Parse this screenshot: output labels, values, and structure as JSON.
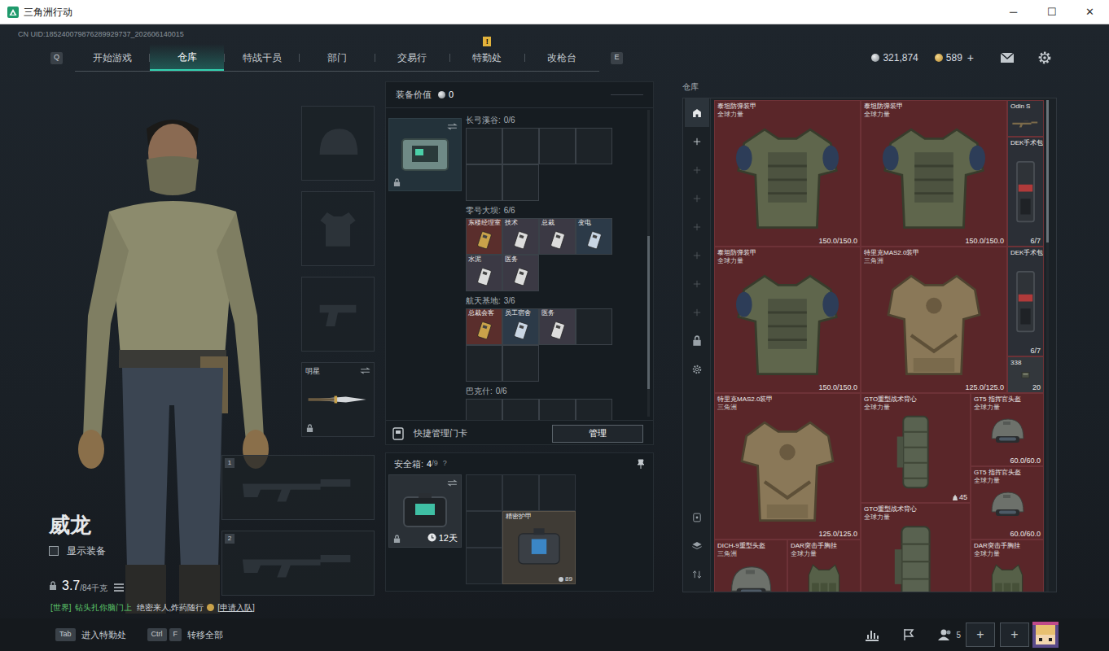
{
  "window": {
    "title": "三角洲行动",
    "controls": [
      "─",
      "☐",
      "✕"
    ]
  },
  "uid": "CN UID:185240079876289929737_202606140015",
  "nav": {
    "prev_key": "Q",
    "next_key": "E",
    "tabs": [
      {
        "label": "开始游戏",
        "selected": false
      },
      {
        "label": "仓库",
        "selected": true
      },
      {
        "label": "特战干员",
        "selected": false
      },
      {
        "label": "部门",
        "selected": false
      },
      {
        "label": "交易行",
        "selected": false
      },
      {
        "label": "特勤处",
        "selected": false,
        "badge": "!"
      },
      {
        "label": "改枪台",
        "selected": false
      }
    ]
  },
  "currency": [
    {
      "kind": "silver",
      "amount": "321,874"
    },
    {
      "kind": "gold",
      "amount": "589",
      "add": "+"
    }
  ],
  "character": {
    "name": "威龙",
    "show_equipment": {
      "label": "显示装备",
      "checked": false
    },
    "weight": "3.7",
    "weight_capacity": "/84千克"
  },
  "loadout": {
    "slots": [
      {
        "kind": "helmet",
        "filled": false
      },
      {
        "kind": "armor",
        "filled": false
      },
      {
        "kind": "pistol",
        "filled": false
      },
      {
        "kind": "melee",
        "filled": true,
        "label": "明星",
        "locked": true
      }
    ],
    "weapons": [
      {
        "number": "1"
      },
      {
        "number": "2"
      }
    ]
  },
  "chat": {
    "channel": "[世界]",
    "sender": "钻头扎你脑门上",
    "message": "绝密来人,炸药随行",
    "action": "[申请入队]"
  },
  "shortcuts": [
    {
      "keys": [
        "Tab"
      ],
      "label": "进入特勤处"
    },
    {
      "keys": [
        "Ctrl",
        "F"
      ],
      "label": "转移全部"
    }
  ],
  "social": {
    "friends": "5",
    "slots": [
      "+",
      "+"
    ]
  },
  "keycards": {
    "title": "装备价值",
    "value": "0",
    "regions": [
      {
        "name": "长弓溪谷:",
        "count": "0/6",
        "cards": []
      },
      {
        "name": "零号大坝:",
        "count": "6/6",
        "cards": [
          {
            "name": "东楼经理室",
            "color": "#5a2e2c",
            "face": "#c9a24a"
          },
          {
            "name": "技术",
            "color": "#3b3944",
            "face": "#dcdcdc"
          },
          {
            "name": "总裁",
            "color": "#3b3944",
            "face": "#dcdcdc"
          },
          {
            "name": "变电",
            "color": "#2c3a48",
            "face": "#c9d6e4"
          },
          {
            "name": "水泥",
            "color": "#3b3944",
            "face": "#dcdcdc"
          },
          {
            "name": "医务",
            "color": "#3b3944",
            "face": "#dcdcdc"
          }
        ]
      },
      {
        "name": "航天基地:",
        "count": "3/6",
        "cards": [
          {
            "name": "总裁会客",
            "color": "#5a2e2c",
            "face": "#c9a24a"
          },
          {
            "name": "员工宿舍",
            "color": "#2c3a48",
            "face": "#c9d6e4"
          },
          {
            "name": "医务",
            "color": "#3b3944",
            "face": "#dcdcdc"
          }
        ]
      },
      {
        "name": "巴克什:",
        "count": "0/6",
        "cards": []
      }
    ],
    "scrollbar": {
      "offset": 0.41,
      "size": 0.5
    },
    "manage_label": "快捷管理门卡",
    "manage_button": "管理"
  },
  "safe_box": {
    "title": "安全箱:",
    "count": "4",
    "capacity": "/9",
    "help": "?",
    "days": "12天",
    "items": [
      {
        "name": "精密护甲",
        "value": "89"
      }
    ]
  },
  "warehouse": {
    "title": "仓库",
    "tabs": [
      {
        "kind": "home",
        "selected": true,
        "enabled": true
      },
      {
        "kind": "add",
        "selected": false,
        "enabled": true
      },
      {
        "kind": "add",
        "selected": false,
        "enabled": false
      },
      {
        "kind": "add",
        "selected": false,
        "enabled": false
      },
      {
        "kind": "add",
        "selected": false,
        "enabled": false
      },
      {
        "kind": "add",
        "selected": false,
        "enabled": false
      },
      {
        "kind": "add",
        "selected": false,
        "enabled": false
      },
      {
        "kind": "add",
        "selected": false,
        "enabled": false
      },
      {
        "kind": "lock",
        "selected": false,
        "enabled": true
      },
      {
        "kind": "settings",
        "selected": false,
        "enabled": true
      }
    ],
    "lower_tabs": [
      {
        "kind": "container"
      },
      {
        "kind": "layers"
      },
      {
        "kind": "sort"
      }
    ],
    "scrollbar": {
      "offset": 0,
      "size": 0.29
    },
    "items": [
      {
        "name": "泰坦防弹装甲",
        "faction": "全球力量",
        "value": "150.0/150.0",
        "kind": "heavy_armor",
        "color": "#5a2629"
      },
      {
        "name": "泰坦防弹装甲",
        "faction": "全球力量",
        "value": "150.0/150.0",
        "kind": "heavy_armor",
        "color": "#5a2629"
      },
      {
        "name": "Odin S",
        "kind": "rifle",
        "color": "#2b2f36"
      },
      {
        "name": "DEK手术包",
        "value": "6/7",
        "kind": "medkit",
        "color": "#2b2f36"
      },
      {
        "name": "泰坦防弹装甲",
        "faction": "全球力量",
        "value": "150.0/150.0",
        "kind": "heavy_armor",
        "color": "#5a2629"
      },
      {
        "name": "特里克MAS2.0装甲",
        "faction": "三角洲",
        "value": "125.0/125.0",
        "kind": "camo_armor",
        "color": "#5a2629"
      },
      {
        "name": "DEK手术包",
        "value": "6/7",
        "kind": "medkit",
        "color": "#2b2f36"
      },
      {
        "name": "338",
        "value": "20",
        "kind": "ammo",
        "color": "#33373c"
      },
      {
        "name": "特里克MAS2.0装甲",
        "faction": "三角洲",
        "value": "125.0/125.0",
        "kind": "camo_armor",
        "color": "#5a2629"
      },
      {
        "name": "GTO重型战术背心",
        "faction": "全球力量",
        "value": "45",
        "kind": "vest",
        "color": "#5a2629"
      },
      {
        "name": "GT5 指挥官头盔",
        "faction": "全球力量",
        "value": "60.0/60.0",
        "kind": "helmet",
        "color": "#5a2629"
      },
      {
        "name": "GT5 指挥官头盔",
        "faction": "全球力量",
        "value": "60.0/60.0",
        "kind": "helmet",
        "color": "#5a2629"
      },
      {
        "name": "GTO重型战术背心",
        "faction": "全球力量",
        "kind": "vest",
        "color": "#5a2629"
      },
      {
        "name": "DICH-9重型头盔",
        "faction": "三角洲",
        "kind": "helmet",
        "color": "#5a2629"
      },
      {
        "name": "DAR突击手胸挂",
        "faction": "全球力量",
        "kind": "rig",
        "color": "#5a2629"
      },
      {
        "name": "DAR突击手胸挂",
        "faction": "全球力量",
        "kind": "rig",
        "color": "#5a2629"
      }
    ]
  }
}
